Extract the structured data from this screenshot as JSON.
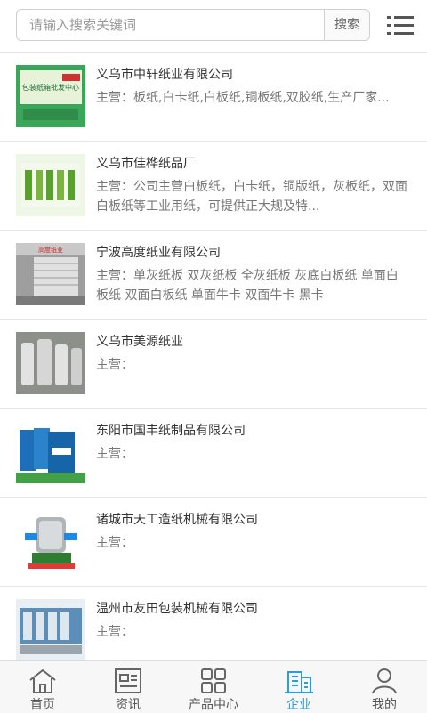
{
  "search": {
    "placeholder": "请输入搜索关键词",
    "button_label": "搜索"
  },
  "companies": [
    {
      "name": "义乌市中轩纸业有限公司",
      "desc": "主营：板纸,白卡纸,白板纸,铜板纸,双胶纸,生产厂家..."
    },
    {
      "name": "义乌市佳桦纸品厂",
      "desc": "主营：公司主营白板纸，白卡纸，铜版纸，灰板纸，双面白板纸等工业用纸，可提供正大规及特..."
    },
    {
      "name": "宁波高度纸业有限公司",
      "desc": "主营：单灰纸板 双灰纸板 全灰纸板 灰底白板纸 单面白板纸 双面白板纸 单面牛卡 双面牛卡 黑卡"
    },
    {
      "name": "义乌市美源纸业",
      "desc": "主营："
    },
    {
      "name": "东阳市国丰纸制品有限公司",
      "desc": "主营："
    },
    {
      "name": "诸城市天工造纸机械有限公司",
      "desc": "主营："
    },
    {
      "name": "温州市友田包装机械有限公司",
      "desc": "主营："
    }
  ],
  "thumb_text": {
    "t1": "包装纸箱批发中心",
    "t3": "高度纸业"
  },
  "tabs": [
    {
      "label": "首页",
      "icon": "home-icon"
    },
    {
      "label": "资讯",
      "icon": "news-icon"
    },
    {
      "label": "产品中心",
      "icon": "grid-icon"
    },
    {
      "label": "企业",
      "icon": "building-icon",
      "active": true
    },
    {
      "label": "我的",
      "icon": "user-icon"
    }
  ],
  "colors": {
    "accent": "#2b9ed8",
    "text": "#333333",
    "muted": "#777777",
    "border": "#e6e6e6"
  }
}
